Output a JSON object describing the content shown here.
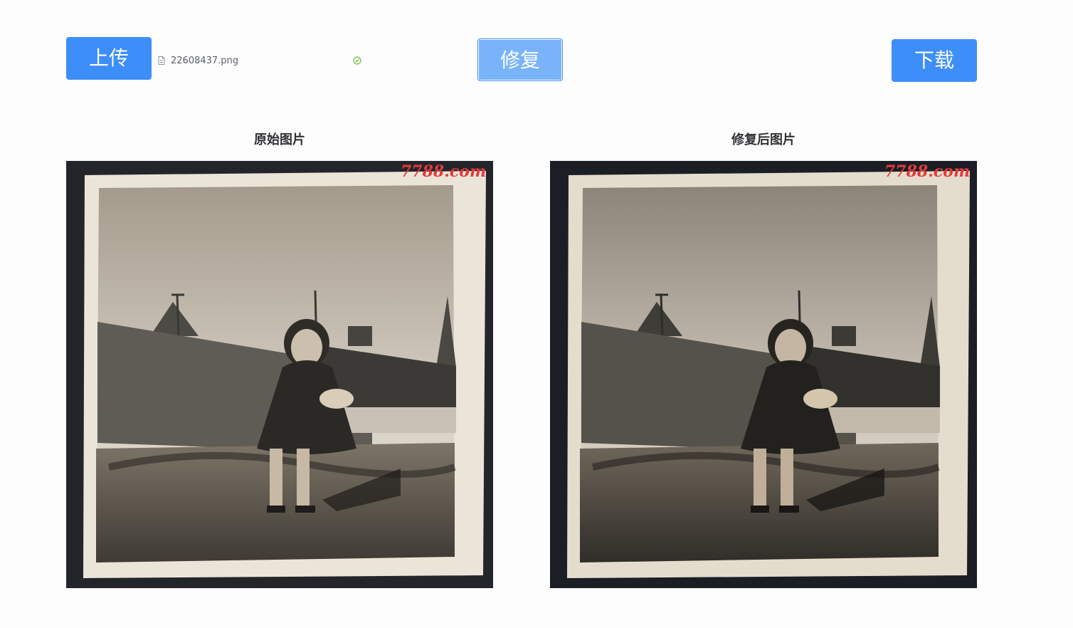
{
  "toolbar": {
    "upload_label": "上传",
    "repair_label": "修复",
    "download_label": "下载"
  },
  "file_list": {
    "items": [
      {
        "name": "22608437.png",
        "status": "success"
      }
    ]
  },
  "panels": {
    "original": {
      "caption": "原始图片",
      "watermark": "7788.com"
    },
    "restored": {
      "caption": "修复后图片",
      "watermark": "7788.com"
    }
  },
  "colors": {
    "primary": "#3d8ef8",
    "primary_light": "#79b4fb",
    "success": "#67c23a"
  },
  "icons": {
    "file": "document-icon",
    "status": "circle-check-icon"
  }
}
